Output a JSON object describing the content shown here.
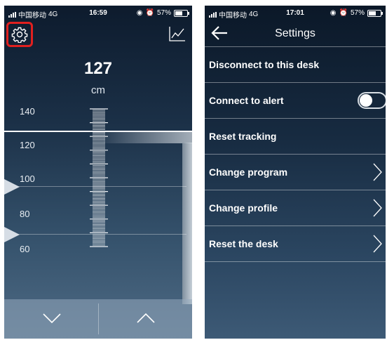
{
  "left_screen": {
    "status": {
      "carrier": "中国移动",
      "network": "4G",
      "time": "16:59",
      "battery": "57%"
    },
    "icons": {
      "settings": "gear-icon",
      "history": "line-chart-icon"
    },
    "height": {
      "value": "127",
      "unit": "cm"
    },
    "scale_labels": [
      "140",
      "120",
      "100",
      "80",
      "60"
    ],
    "controls": {
      "down": "chevron-down-icon",
      "up": "chevron-up-icon"
    }
  },
  "right_screen": {
    "status": {
      "carrier": "中国移动",
      "network": "4G",
      "time": "17:01",
      "battery": "57%"
    },
    "title": "Settings",
    "items": [
      {
        "label": "Disconnect to this desk",
        "control": "none"
      },
      {
        "label": "Connect to alert",
        "control": "toggle",
        "state": "off"
      },
      {
        "label": "Reset tracking",
        "control": "none"
      },
      {
        "label": "Change program",
        "control": "chevron"
      },
      {
        "label": "Change profile",
        "control": "chevron"
      },
      {
        "label": "Reset the desk",
        "control": "chevron"
      }
    ]
  },
  "colors": {
    "highlight": "#e0201f",
    "text": "#ffffff"
  }
}
